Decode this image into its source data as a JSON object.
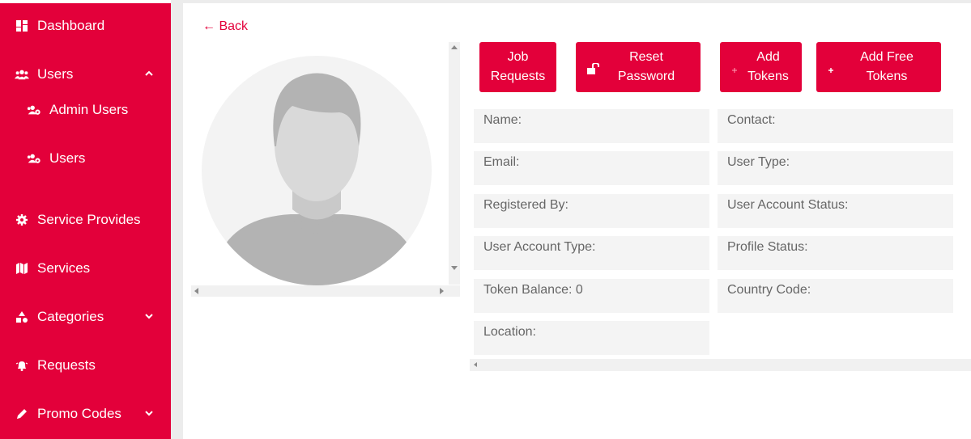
{
  "sidebar": {
    "items": [
      {
        "label": "Dashboard",
        "icon": "dashboard-icon"
      },
      {
        "label": "Users",
        "icon": "users-icon",
        "expanded": true
      },
      {
        "label": "Admin Users",
        "icon": "user-cog-icon"
      },
      {
        "label": "Users",
        "icon": "user-cog-icon"
      },
      {
        "label": "Service Provides",
        "icon": "gear-icon"
      },
      {
        "label": "Services",
        "icon": "map-icon"
      },
      {
        "label": "Categories",
        "icon": "shapes-icon"
      },
      {
        "label": "Requests",
        "icon": "bell-icon"
      },
      {
        "label": "Promo Codes",
        "icon": "pencil-icon"
      }
    ]
  },
  "main": {
    "back_label": "← Back",
    "buttons": {
      "job_requests": "Job Requests",
      "reset_password": "Reset Password",
      "add_tokens": "Add Tokens",
      "add_free_tokens": "Add Free Tokens"
    },
    "fields": {
      "name": "Name:",
      "contact": "Contact:",
      "email": "Email:",
      "user_type": "User Type:",
      "registered_by": "Registered By:",
      "user_account_status": "User Account Status:",
      "user_account_type": "User Account Type:",
      "profile_status": "Profile Status:",
      "token_balance": "Token Balance: 0",
      "country_code": "Country Code:",
      "location": "Location:"
    }
  },
  "colors": {
    "accent": "#e3003a",
    "field_bg": "#f4f4f4",
    "page_bg": "#ececec"
  }
}
